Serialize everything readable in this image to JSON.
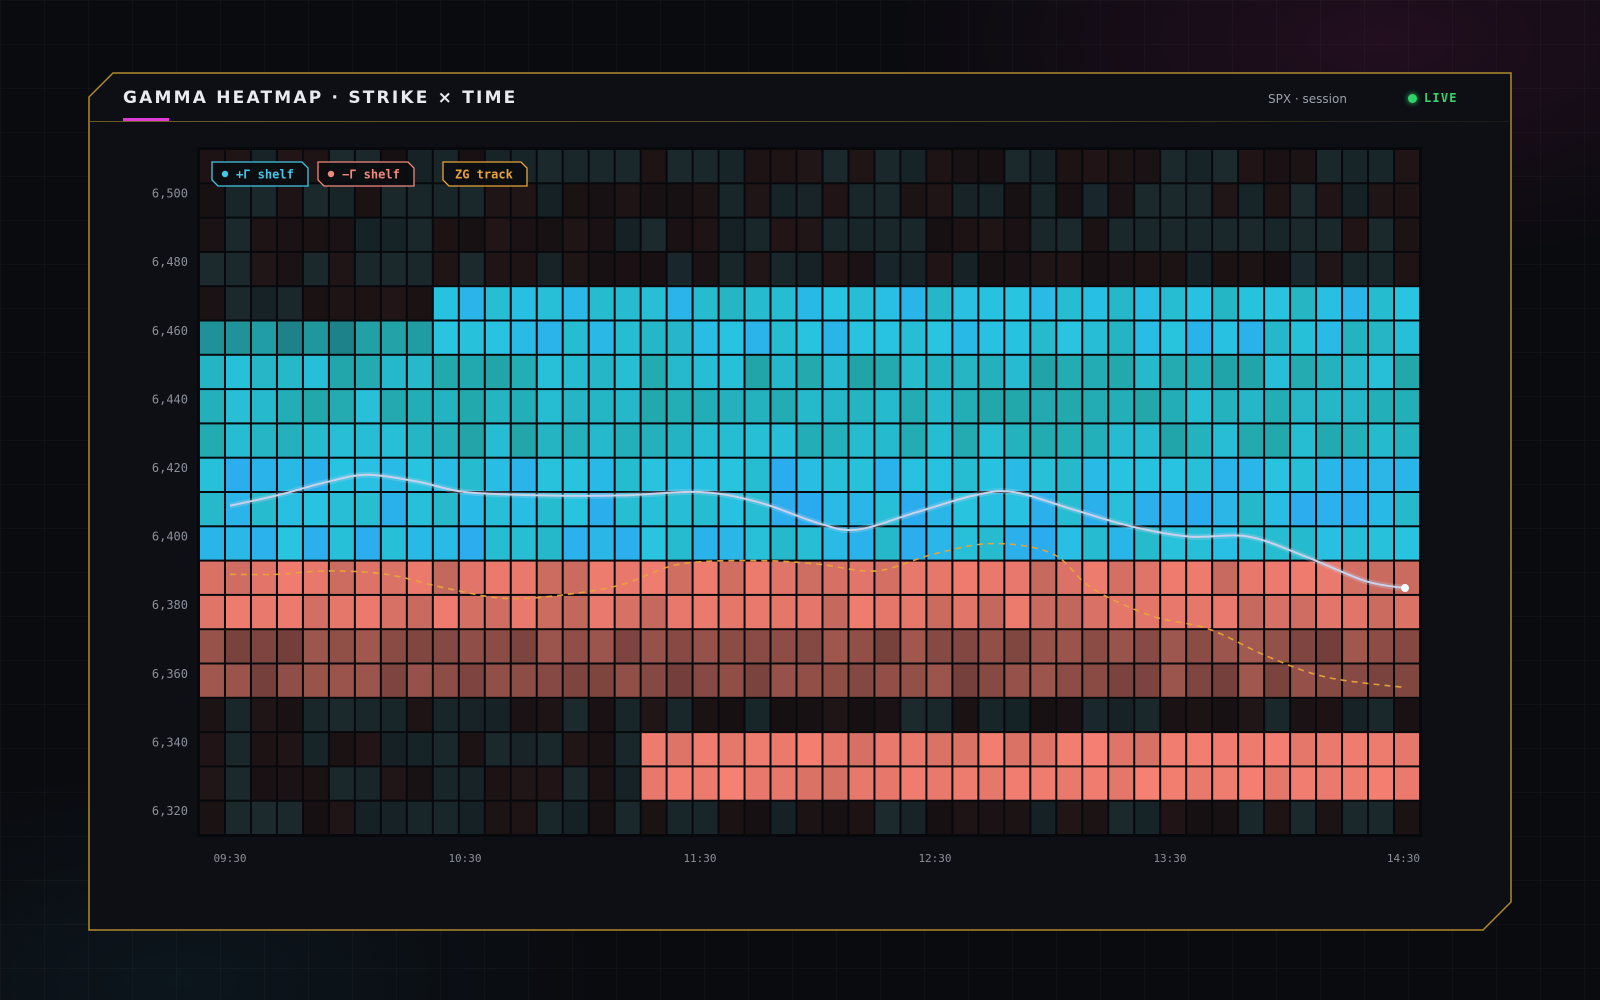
{
  "header": {
    "title": "GAMMA HEATMAP · STRIKE × TIME",
    "session": "SPX · session",
    "live": "LIVE"
  },
  "colors": {
    "frame": "#b08a2c",
    "title_accent": "#e03bd6",
    "positive_gamma": "#2fa8f0",
    "negative_gamma": "#f07a6e",
    "price_line": "#c8d2ea",
    "zero_gamma_track": "#e8a43a",
    "live": "#35d46e"
  },
  "chart_data": {
    "type": "heatmap",
    "title": "GAMMA HEATMAP · STRIKE × TIME",
    "y_tick_labels": [
      "6,500",
      "6,480",
      "6,460",
      "6,440",
      "6,420",
      "6,400",
      "6,380",
      "6,360",
      "6,340",
      "6,320"
    ],
    "x_tick_labels": [
      "09:30",
      "10:30",
      "11:30",
      "12:30",
      "13:30",
      "14:30"
    ],
    "ylim": [
      6313,
      6513
    ],
    "x_range": [
      "09:30",
      "14:30"
    ],
    "strike_step": 10,
    "time_step_minutes": 6.4,
    "rows": 20,
    "cols": 47,
    "legend": [
      {
        "key": "pos",
        "label": "+Γ shelf",
        "color": "#45c6e6"
      },
      {
        "key": "neg",
        "label": "−Γ shelf",
        "color": "#f08a7c"
      },
      {
        "key": "zg",
        "label": "ZG track",
        "color": "#e8a43a"
      }
    ],
    "regions": [
      {
        "sign": "positive",
        "strike_range": [
          6455,
          6475
        ],
        "time_range": [
          "10:30",
          "14:30"
        ],
        "intensity": 0.75
      },
      {
        "sign": "positive",
        "strike_range": [
          6445,
          6465
        ],
        "time_range": [
          "09:30",
          "10:30"
        ],
        "intensity": 0.4
      },
      {
        "sign": "positive",
        "strike_range": [
          6425,
          6455
        ],
        "time_range": [
          "09:30",
          "14:30"
        ],
        "intensity": 0.6
      },
      {
        "sign": "positive",
        "strike_range": [
          6395,
          6425
        ],
        "time_range": [
          "09:30",
          "14:30"
        ],
        "intensity": 0.8
      },
      {
        "sign": "negative",
        "strike_range": [
          6375,
          6420
        ],
        "time_range": [
          "09:30",
          "14:30"
        ],
        "intensity": 0.75
      },
      {
        "sign": "negative",
        "strike_range": [
          6355,
          6385
        ],
        "time_range": [
          "09:30",
          "14:30"
        ],
        "intensity": 0.4
      },
      {
        "sign": "negative",
        "strike_range": [
          6325,
          6345
        ],
        "time_range": [
          "11:20",
          "14:30"
        ],
        "intensity": 0.85
      }
    ],
    "series": [
      {
        "type": "line",
        "x": [
          "09:30",
          "09:42",
          "09:55",
          "10:05",
          "10:18",
          "10:30",
          "10:50",
          "11:10",
          "11:30",
          "11:45",
          "12:00",
          "12:10",
          "12:25",
          "12:40",
          "12:50",
          "13:05",
          "13:20",
          "13:35",
          "13:50",
          "14:05",
          "14:20",
          "14:30"
        ],
        "y": [
          6409,
          6412,
          6416,
          6418,
          6416,
          6413,
          6412,
          6412,
          6413,
          6410,
          6404,
          6402,
          6407,
          6412,
          6413,
          6408,
          6403,
          6400,
          6400,
          6394,
          6387,
          6385
        ]
      },
      {
        "type": "line",
        "style": "dashed",
        "x": [
          "09:30",
          "09:42",
          "09:55",
          "10:10",
          "10:25",
          "10:40",
          "10:55",
          "11:10",
          "11:25",
          "11:45",
          "12:00",
          "12:15",
          "12:30",
          "12:45",
          "13:00",
          "13:10",
          "13:25",
          "13:40",
          "13:55",
          "14:10",
          "14:30"
        ],
        "y": [
          6389,
          6389,
          6390,
          6389,
          6385,
          6382,
          6383,
          6386,
          6392,
          6393,
          6392,
          6390,
          6395,
          6398,
          6395,
          6385,
          6377,
          6373,
          6365,
          6359,
          6356
        ]
      }
    ]
  }
}
